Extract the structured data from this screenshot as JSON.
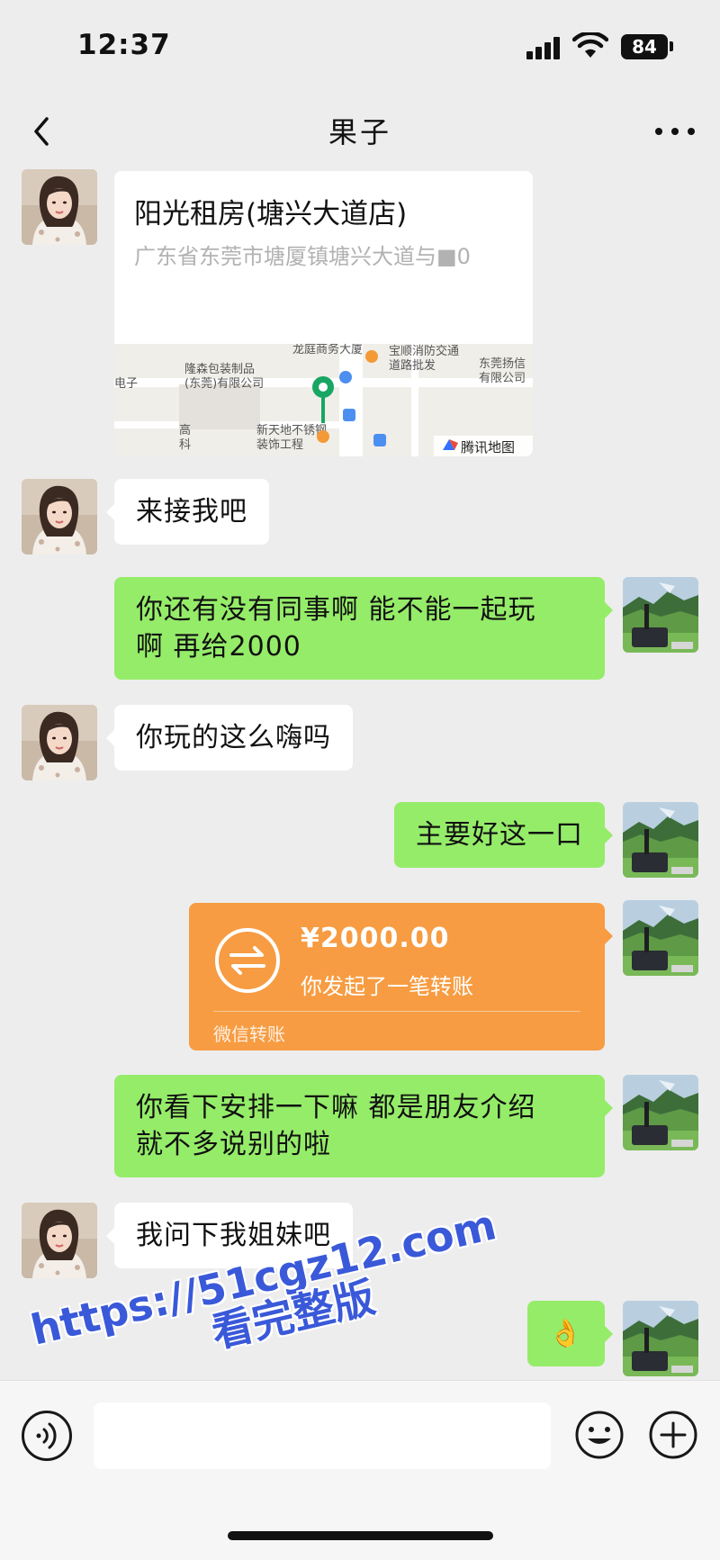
{
  "status_bar": {
    "time": "12:37",
    "battery": "84"
  },
  "nav": {
    "title": "果子"
  },
  "messages": [
    {
      "type": "location",
      "name": "阳光租房(塘兴大道店)",
      "address": "广东省东莞市塘厦镇塘兴大道与■0",
      "map_labels": [
        "龙庭商务大厦",
        "宝顺消防交通",
        "道路批发",
        "东莞扬信",
        "有限公司",
        "隆森包装制品",
        "(东莞)有限公司",
        "电子",
        "新天地不锈钢",
        "装饰工程",
        "腾讯地图",
        "高",
        "科"
      ]
    },
    {
      "type": "text",
      "side": "in",
      "text": "来接我吧"
    },
    {
      "type": "text",
      "side": "out",
      "lines": [
        "你还有没有同事啊 能不能一起玩",
        "啊 再给2000"
      ]
    },
    {
      "type": "text",
      "side": "in",
      "text": "你玩的这么嗨吗"
    },
    {
      "type": "text",
      "side": "out",
      "text": "主要好这一口"
    },
    {
      "type": "transfer",
      "side": "out",
      "amount": "¥2000.00",
      "desc": "你发起了一笔转账",
      "brand": "微信转账"
    },
    {
      "type": "text",
      "side": "out",
      "lines": [
        "你看下安排一下嘛 都是朋友介绍",
        "就不多说别的啦"
      ]
    },
    {
      "type": "text",
      "side": "in",
      "text": "我问下我姐妹吧"
    },
    {
      "type": "emoji",
      "side": "out",
      "text": "👌"
    }
  ],
  "watermark": {
    "url": "https://51cgz12.com",
    "sub": "看完整版"
  },
  "input": {
    "placeholder": ""
  },
  "colors": {
    "background": "#ededed",
    "bubble_out": "#95ec69",
    "bubble_in": "#ffffff",
    "transfer": "#f79c42",
    "watermark": "#3a59d9"
  }
}
